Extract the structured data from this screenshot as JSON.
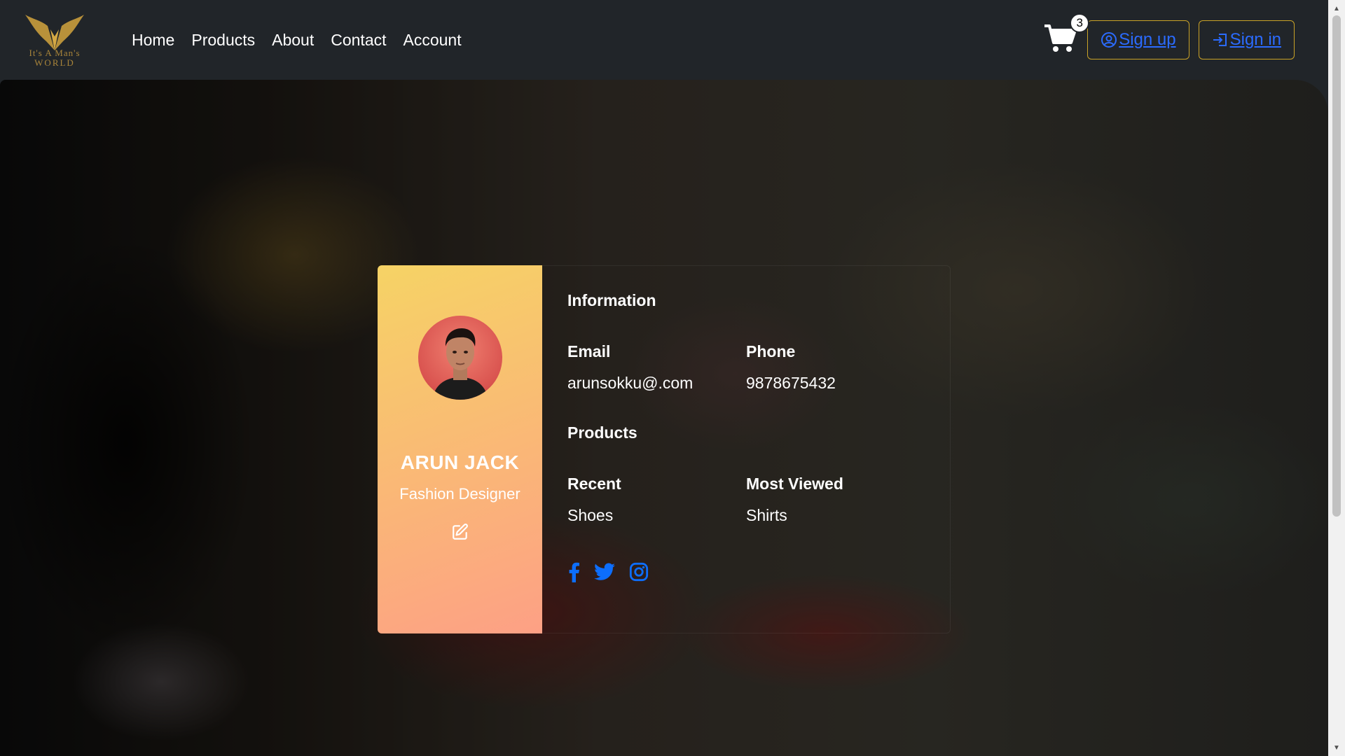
{
  "brand": {
    "line1": "It's A Man's",
    "line2": "WORLD"
  },
  "nav": {
    "links": [
      "Home",
      "Products",
      "About",
      "Contact",
      "Account"
    ],
    "cart_count": "3",
    "signup_label": "Sign up",
    "signin_label": "Sign in"
  },
  "profile": {
    "name": "ARUN JACK",
    "role": "Fashion Designer",
    "information_title": "Information",
    "email_label": "Email",
    "email_value": "arunsokku@.com",
    "phone_label": "Phone",
    "phone_value": "9878675432",
    "products_title": "Products",
    "recent_label": "Recent",
    "recent_value": "Shoes",
    "most_viewed_label": "Most Viewed",
    "most_viewed_value": "Shirts"
  },
  "socials": [
    "facebook-icon",
    "twitter-icon",
    "instagram-icon"
  ],
  "colors": {
    "navbar": "#212529",
    "accent_border": "#c9a227",
    "link_blue": "#2b6bff",
    "card_gradient_start": "#f6d365",
    "card_gradient_end": "#fda085",
    "social_blue": "#0d6efd"
  }
}
